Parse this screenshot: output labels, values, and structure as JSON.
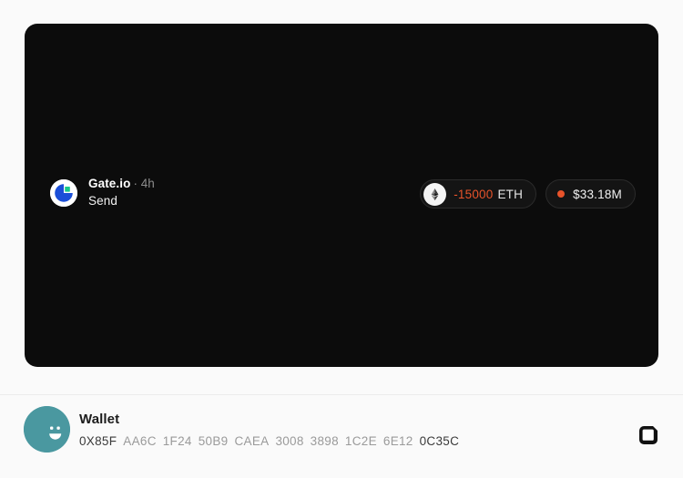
{
  "card": {
    "source": {
      "logo_icon": "gate-io-logo-icon",
      "name": "Gate.io",
      "meta": "· 4h",
      "action": "Send"
    },
    "amount_pill": {
      "token_icon": "ethereum-icon",
      "value": "-15000",
      "unit": "ETH",
      "value_color": "#e8532a"
    },
    "usd_pill": {
      "status_dot_color": "#e8532a",
      "value": "$33.18M"
    },
    "background_color": "#0c0c0c"
  },
  "wallet": {
    "avatar_icon": "smiley-avatar-icon",
    "avatar_color": "#4a98a0",
    "title": "Wallet",
    "address_segments": [
      {
        "text": "0X85F",
        "strong": true
      },
      {
        "text": "AA6C",
        "strong": false
      },
      {
        "text": "1F24",
        "strong": false
      },
      {
        "text": "50B9",
        "strong": false
      },
      {
        "text": "CAEA",
        "strong": false
      },
      {
        "text": "3008",
        "strong": false
      },
      {
        "text": "3898",
        "strong": false
      },
      {
        "text": "1C2E",
        "strong": false
      },
      {
        "text": "6E12",
        "strong": false
      },
      {
        "text": "0C35C",
        "strong": true
      }
    ],
    "copy_icon": "copy-icon"
  },
  "page": {
    "background_color": "#fafafa",
    "divider_color": "#ececec"
  }
}
